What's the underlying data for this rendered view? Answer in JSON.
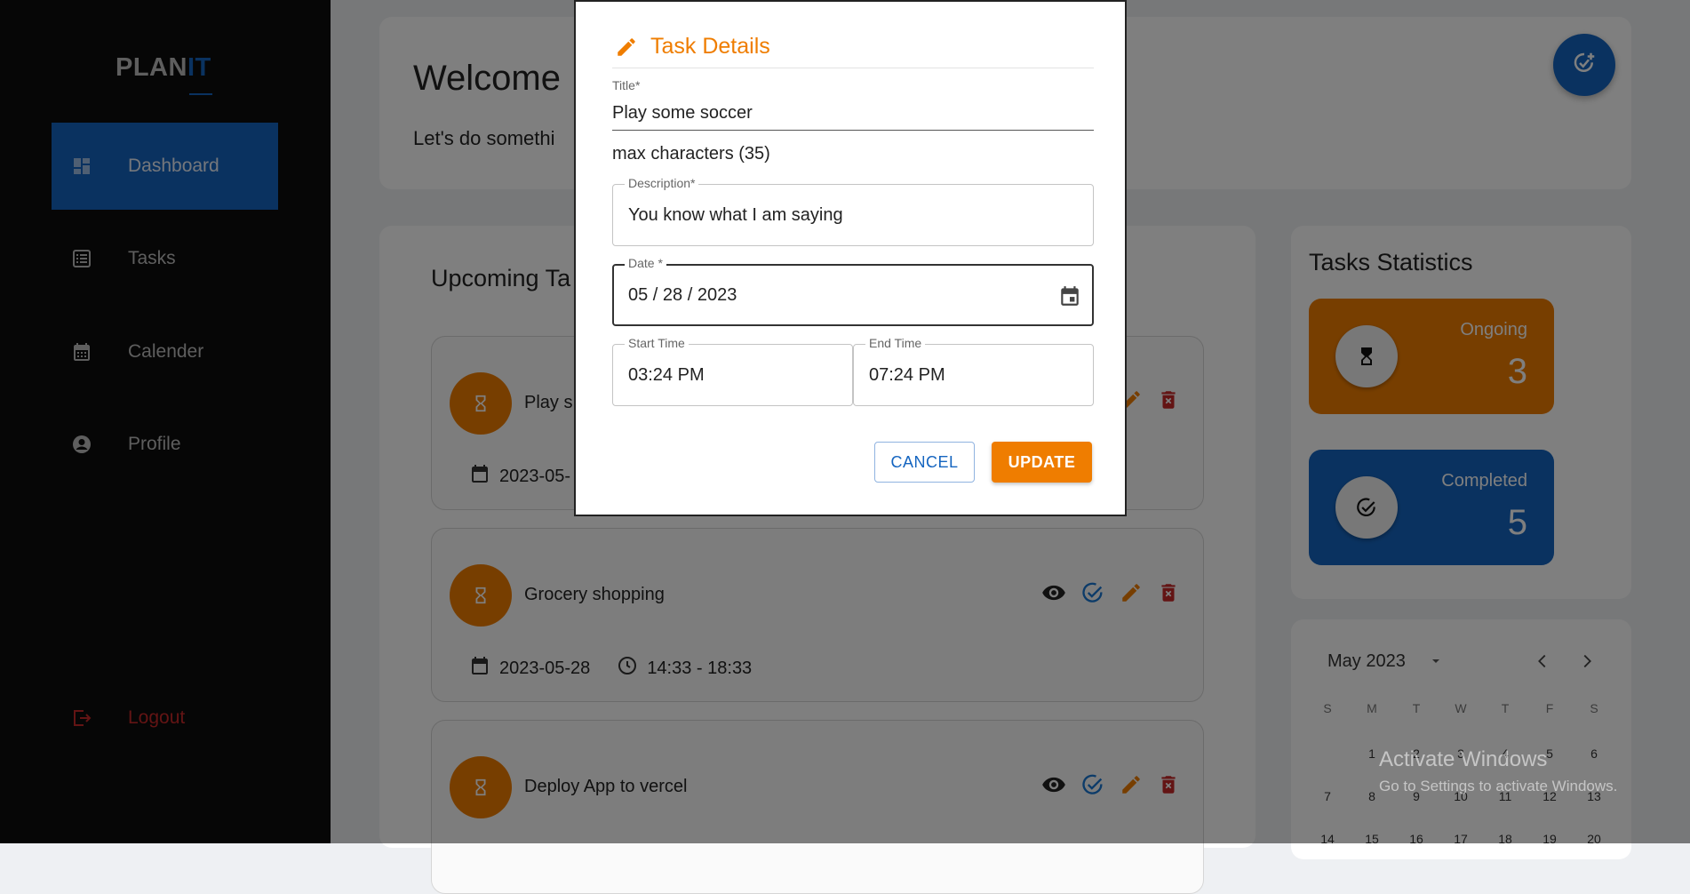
{
  "sidebar": {
    "logo_main": "PLAN",
    "logo_accent": "IT",
    "items": [
      {
        "label": "Dashboard",
        "icon": "dashboard-icon"
      },
      {
        "label": "Tasks",
        "icon": "list-icon"
      },
      {
        "label": "Calender",
        "icon": "calendar-icon"
      },
      {
        "label": "Profile",
        "icon": "account-circle-icon"
      }
    ],
    "logout": "Logout"
  },
  "welcome": {
    "title": "Welcome",
    "subtitle": "Let's do somethi"
  },
  "upcoming": {
    "title": "Upcoming Ta",
    "tasks": [
      {
        "name": "Play s",
        "date": "2023-05-",
        "time": ""
      },
      {
        "name": "Grocery shopping",
        "date": "2023-05-28",
        "time": "14:33 - 18:33"
      },
      {
        "name": "Deploy App to vercel",
        "date": "",
        "time": ""
      }
    ]
  },
  "stats": {
    "title": "Tasks Statistics",
    "ongoing_label": "Ongoing",
    "ongoing_value": "3",
    "completed_label": "Completed",
    "completed_value": "5"
  },
  "calendar": {
    "month": "May 2023",
    "weekdays": [
      "S",
      "M",
      "T",
      "W",
      "T",
      "F",
      "S"
    ],
    "weeks": [
      [
        "",
        "1",
        "2",
        "3",
        "4",
        "5",
        "6"
      ],
      [
        "7",
        "8",
        "9",
        "10",
        "11",
        "12",
        "13"
      ],
      [
        "14",
        "15",
        "16",
        "17",
        "18",
        "19",
        "20"
      ]
    ]
  },
  "watermark": {
    "line1": "Activate Windows",
    "line2": "Go to Settings to activate Windows."
  },
  "modal": {
    "title": "Task Details",
    "title_label": "Title",
    "title_value": "Play some soccer",
    "helper": "max characters (35)",
    "description_label": "Description",
    "description_value": "You know what I am saying",
    "date_label": "Date",
    "date_value": "05 / 28 / 2023",
    "start_label": "Start Time",
    "start_value": "03:24 PM",
    "end_label": "End Time",
    "end_value": "07:24 PM",
    "required_mark": "*",
    "cancel": "CANCEL",
    "update": "UPDATE"
  },
  "colors": {
    "accent_blue": "#1565c0",
    "accent_orange": "#ef7d00",
    "danger_red": "#c62828"
  }
}
